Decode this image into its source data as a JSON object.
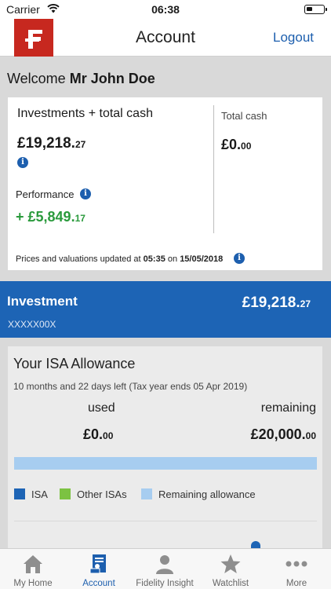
{
  "status_bar": {
    "carrier": "Carrier",
    "time": "06:38"
  },
  "nav": {
    "title": "Account",
    "logout": "Logout"
  },
  "welcome": {
    "prefix": "Welcome",
    "name": "Mr John Doe"
  },
  "summary": {
    "investments_label": "Investments + total cash",
    "investments_value_main": "£19,218.",
    "investments_value_pence": "27",
    "performance_label": "Performance",
    "performance_value_main": "+ £5,849.",
    "performance_value_pence": "17",
    "cash_label": "Total cash",
    "cash_value_main": "£0.",
    "cash_value_pence": "00",
    "updated_prefix": "Prices and valuations updated at",
    "updated_time": "05:35",
    "updated_on": "on",
    "updated_date": "15/05/2018",
    "info_glyph": "i"
  },
  "investment": {
    "title": "Investment",
    "account": "XXXXX00X",
    "value_main": "£19,218.",
    "value_pence": "27"
  },
  "isa": {
    "title": "Your ISA Allowance",
    "subtitle": "10 months and 22 days left (Tax year ends 05 Apr 2019)",
    "used_label": "used",
    "remaining_label": "remaining",
    "used_main": "£0.",
    "used_pence": "00",
    "remaining_main": "£20,000.",
    "remaining_pence": "00",
    "used_fraction": 0,
    "legend": [
      {
        "label": "ISA",
        "color": "#1d64b5"
      },
      {
        "label": "Other ISAs",
        "color": "#7cc242"
      },
      {
        "label": "Remaining allowance",
        "color": "#a7cdf0"
      }
    ]
  },
  "tabs": [
    {
      "label": "My Home",
      "icon": "home-icon"
    },
    {
      "label": "Account",
      "icon": "account-icon",
      "active": true
    },
    {
      "label": "Fidelity Insight",
      "icon": "person-icon"
    },
    {
      "label": "Watchlist",
      "icon": "star-icon"
    },
    {
      "label": "More",
      "icon": "more-icon"
    }
  ],
  "colors": {
    "brand_red": "#c7281f",
    "brand_blue": "#1d64b5",
    "positive_green": "#2a9a3c"
  }
}
